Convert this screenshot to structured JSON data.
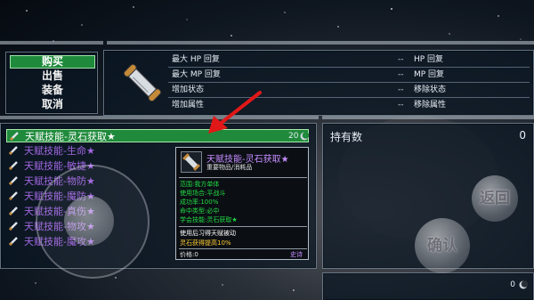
{
  "menu": {
    "items": [
      {
        "label": "购买",
        "selected": true
      },
      {
        "label": "出售",
        "selected": false
      },
      {
        "label": "装备",
        "selected": false
      },
      {
        "label": "取消",
        "selected": false
      }
    ]
  },
  "info": {
    "rows": [
      {
        "left": "最大 HP 回复",
        "dash": "--",
        "right": "HP 回复"
      },
      {
        "left": "最大 MP 回复",
        "dash": "--",
        "right": "MP 回复"
      },
      {
        "left": "增加状态",
        "dash": "--",
        "right": "移除状态"
      },
      {
        "left": "增加属性",
        "dash": "--",
        "right": "移除属性"
      }
    ]
  },
  "list": {
    "items": [
      {
        "name": "天赋技能-灵石获取★",
        "count": "20",
        "selected": true
      },
      {
        "name": "天赋技能-生命★",
        "count": "",
        "selected": false
      },
      {
        "name": "天赋技能-敏捷★",
        "count": "",
        "selected": false
      },
      {
        "name": "天赋技能-物防★",
        "count": "",
        "selected": false
      },
      {
        "name": "天赋技能-魔防★",
        "count": "",
        "selected": false
      },
      {
        "name": "天赋技能-真伤★",
        "count": "",
        "selected": false
      },
      {
        "name": "天赋技能-物攻★",
        "count": "",
        "selected": false
      },
      {
        "name": "天赋技能-魔攻★",
        "count": "",
        "selected": false
      }
    ]
  },
  "hold": {
    "label": "持有数",
    "value": "0"
  },
  "bottom": {
    "value": "0"
  },
  "tooltip": {
    "title": "天赋技能-灵石获取★",
    "subtitle": "重要物品/消耗品",
    "lines": [
      "范围:我方单体",
      "使用场合:平战斗",
      "成功率:100%",
      "命中类型:必中",
      "学会技能:灵石获取★"
    ],
    "desc1": "使用后习得天赋被动",
    "desc2": "灵石获得提高10%",
    "price_label": "价格:0",
    "rarity": "史诗"
  },
  "buttons": {
    "back": "返回",
    "confirm": "确认"
  },
  "colors": {
    "selected_bg": "#1f8a3c",
    "item_name": "#a066e0",
    "tooltip_green": "#22dd44",
    "arrow": "#e01818"
  }
}
